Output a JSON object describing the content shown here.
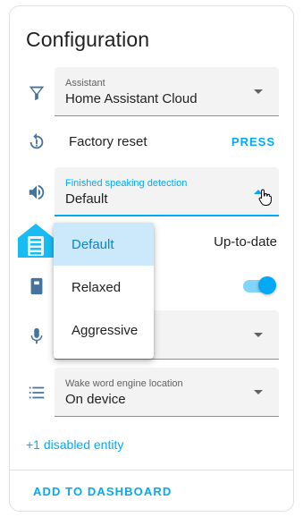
{
  "card": {
    "title": "Configuration",
    "assistant": {
      "label": "Assistant",
      "value": "Home Assistant Cloud"
    },
    "factory_reset": {
      "label": "Factory reset",
      "action": "PRESS"
    },
    "speaking_detection": {
      "label": "Finished speaking detection",
      "value": "Default"
    },
    "firmware": {
      "status": "Up-to-date"
    },
    "wake_word_location": {
      "label": "Wake word engine location",
      "value": "On device"
    },
    "disabled_link": "+1 disabled entity",
    "add_to_dashboard": "ADD TO DASHBOARD"
  },
  "menu": {
    "options": [
      "Default",
      "Relaxed",
      "Aggressive"
    ],
    "selected": "Default"
  },
  "icons": {
    "assistant": "filter-icon",
    "factory_reset": "restart-icon",
    "speaking_detection": "speaker-icon",
    "firmware": "home-assistant-logo",
    "device": "device-icon",
    "microphone": "microphone-icon",
    "wake_word": "list-icon"
  },
  "colors": {
    "accent": "#03a9f4",
    "icon": "#44739e",
    "field_bg": "#f3f3f3",
    "menu_selected_bg": "#cbe9fb"
  }
}
